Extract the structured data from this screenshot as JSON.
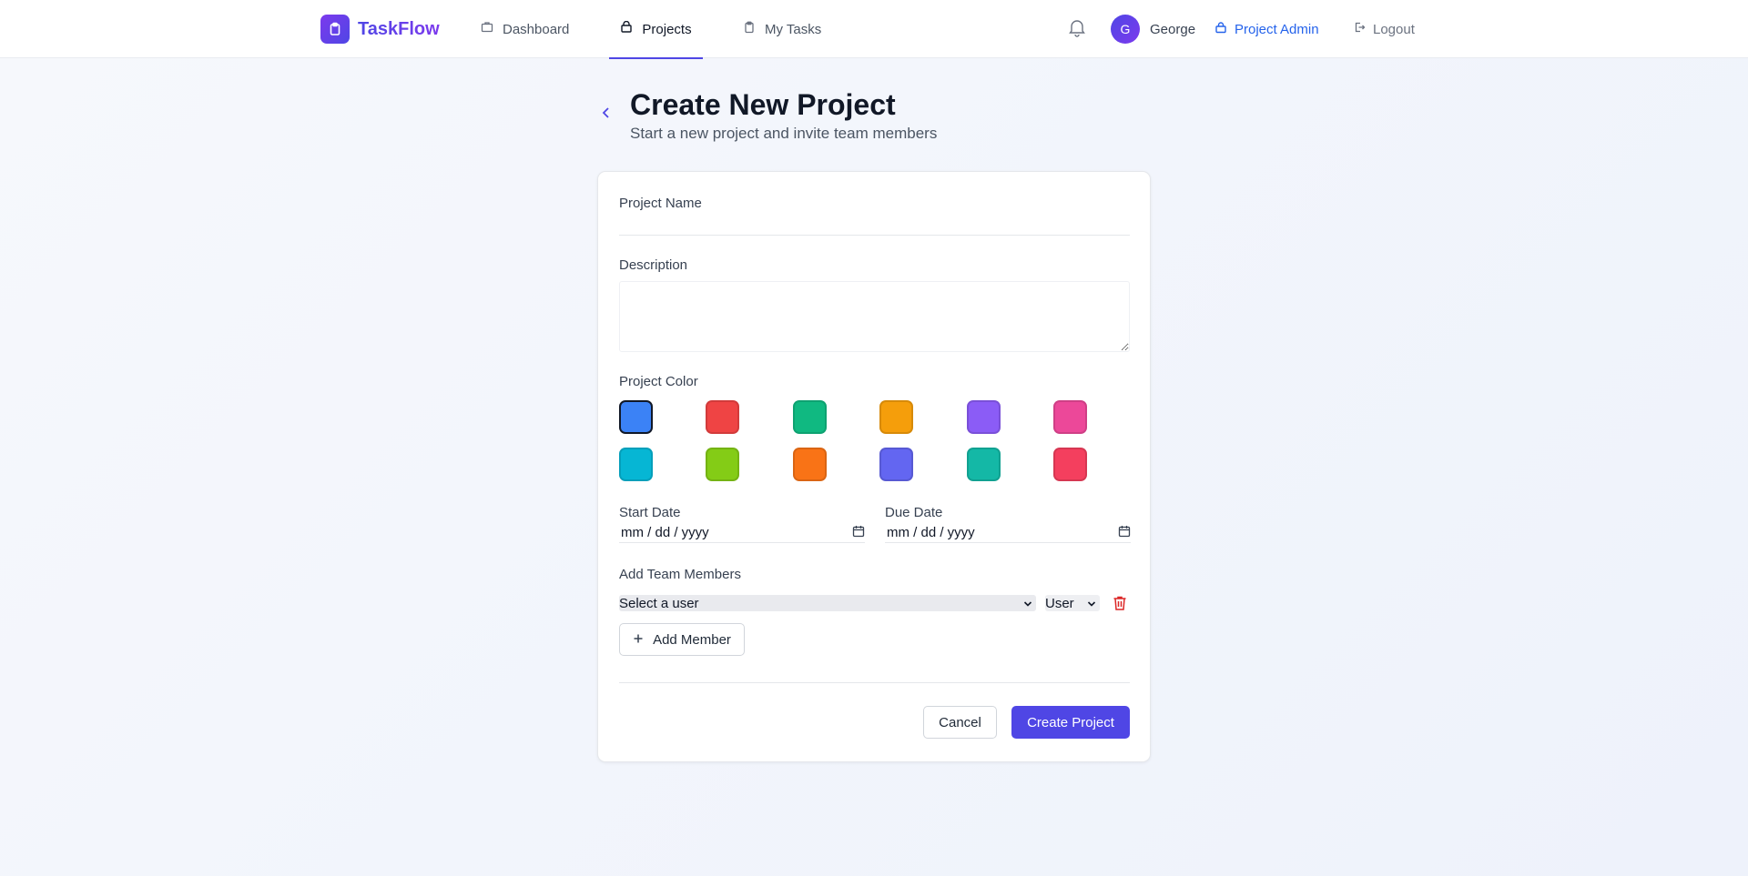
{
  "app": {
    "name": "TaskFlow"
  },
  "nav": {
    "items": [
      {
        "label": "Dashboard",
        "icon": "briefcase-icon"
      },
      {
        "label": "Projects",
        "icon": "folder-icon",
        "active": true
      },
      {
        "label": "My Tasks",
        "icon": "clipboard-icon"
      }
    ],
    "user": {
      "initial": "G",
      "name": "George"
    },
    "role_link": "Project Admin",
    "logout": "Logout"
  },
  "header": {
    "title": "Create New Project",
    "subtitle": "Start a new project and invite team members"
  },
  "form": {
    "name_label": "Project Name",
    "name_value": "",
    "description_label": "Description",
    "description_value": "",
    "color_label": "Project Color",
    "colors": [
      "#3b82f6",
      "#ef4444",
      "#10b981",
      "#f59e0b",
      "#8b5cf6",
      "#ec4899",
      "#06b6d4",
      "#84cc16",
      "#f97316",
      "#6366f1",
      "#14b8a6",
      "#f43f5e"
    ],
    "selected_color": "#3b82f6",
    "start_date_label": "Start Date",
    "start_date_placeholder": "mm / dd / yyyy",
    "due_date_label": "Due Date",
    "due_date_placeholder": "mm / dd / yyyy",
    "team_label": "Add Team Members",
    "member_select": "Select a user",
    "member_role": "User",
    "add_member": "Add Member",
    "cancel": "Cancel",
    "submit": "Create Project"
  },
  "colors": {
    "primary": "#4f46e5",
    "danger": "#dc2626",
    "link": "#2563eb"
  }
}
